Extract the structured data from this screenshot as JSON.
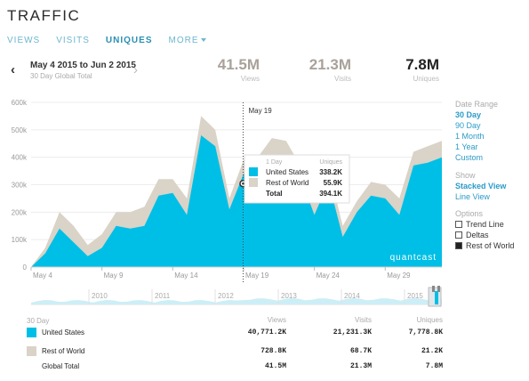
{
  "page": {
    "title": "TRAFFIC"
  },
  "tabs": [
    {
      "label": "VIEWS"
    },
    {
      "label": "VISITS"
    },
    {
      "label": "UNIQUES"
    },
    {
      "label": "MORE"
    }
  ],
  "date_nav": {
    "prev_icon": "chevron-left-icon",
    "next_icon": "chevron-right-icon",
    "range": "May 4 2015 to Jun 2 2015",
    "subtitle": "30 Day Global Total"
  },
  "metrics": [
    {
      "value": "41.5M",
      "label": "Views"
    },
    {
      "value": "21.3M",
      "label": "Visits"
    },
    {
      "value": "7.8M",
      "label": "Uniques"
    }
  ],
  "options_panel": {
    "date_range_head": "Date Range",
    "date_ranges": [
      "30 Day",
      "90 Day",
      "1 Month",
      "1 Year",
      "Custom"
    ],
    "show_head": "Show",
    "show": [
      "Stacked View",
      "Line View"
    ],
    "options_head": "Options",
    "options": [
      {
        "label": "Trend Line",
        "checked": false
      },
      {
        "label": "Deltas",
        "checked": false
      },
      {
        "label": "Rest of World",
        "checked": true
      }
    ]
  },
  "colors": {
    "us": "#00bfe6",
    "row": "#d9d3c8",
    "accent": "#2a9bc7"
  },
  "chart_data": {
    "type": "area",
    "stacked": true,
    "x_labels": [
      "May 4",
      "May 9",
      "May 14",
      "May 19",
      "May 24",
      "May 29"
    ],
    "y_ticks": [
      "0",
      "100k",
      "200k",
      "300k",
      "400k",
      "500k",
      "600k"
    ],
    "ylim": [
      0,
      600000
    ],
    "watermark": "quantcast",
    "marker_label": "May 19",
    "series": [
      {
        "name": "United States",
        "color": "#00bfe6",
        "values": [
          0,
          50000,
          140000,
          90000,
          40000,
          70000,
          150000,
          140000,
          150000,
          260000,
          270000,
          190000,
          480000,
          440000,
          210000,
          340000,
          340000,
          410000,
          410000,
          330000,
          190000,
          310000,
          110000,
          200000,
          260000,
          250000,
          190000,
          370000,
          380000,
          400000
        ]
      },
      {
        "name": "Rest of World",
        "color": "#d9d3c8",
        "values": [
          0,
          20000,
          60000,
          60000,
          40000,
          50000,
          50000,
          60000,
          70000,
          60000,
          50000,
          60000,
          70000,
          60000,
          40000,
          50000,
          60000,
          60000,
          50000,
          40000,
          40000,
          50000,
          40000,
          40000,
          50000,
          50000,
          60000,
          50000,
          60000,
          60000
        ]
      }
    ],
    "tooltip": {
      "head": "1 Day",
      "col_head": "Uniques",
      "rows": [
        {
          "name": "United States",
          "value": "338.2K"
        },
        {
          "name": "Rest of World",
          "value": "55.9K"
        },
        {
          "name": "Total",
          "value": "394.1K"
        }
      ]
    },
    "timeline_years": [
      "2010",
      "2011",
      "2012",
      "2013",
      "2014",
      "2015"
    ]
  },
  "summary": {
    "period": "30 Day",
    "headers": [
      "Views",
      "Visits",
      "Uniques"
    ],
    "rows": [
      {
        "name": "United States",
        "views": "40,771.2K",
        "visits": "21,231.3K",
        "uniques": "7,778.8K"
      },
      {
        "name": "Rest of World",
        "views": "728.8K",
        "visits": "68.7K",
        "uniques": "21.2K"
      },
      {
        "name": "Global Total",
        "views": "41.5M",
        "visits": "21.3M",
        "uniques": "7.8M"
      }
    ]
  }
}
